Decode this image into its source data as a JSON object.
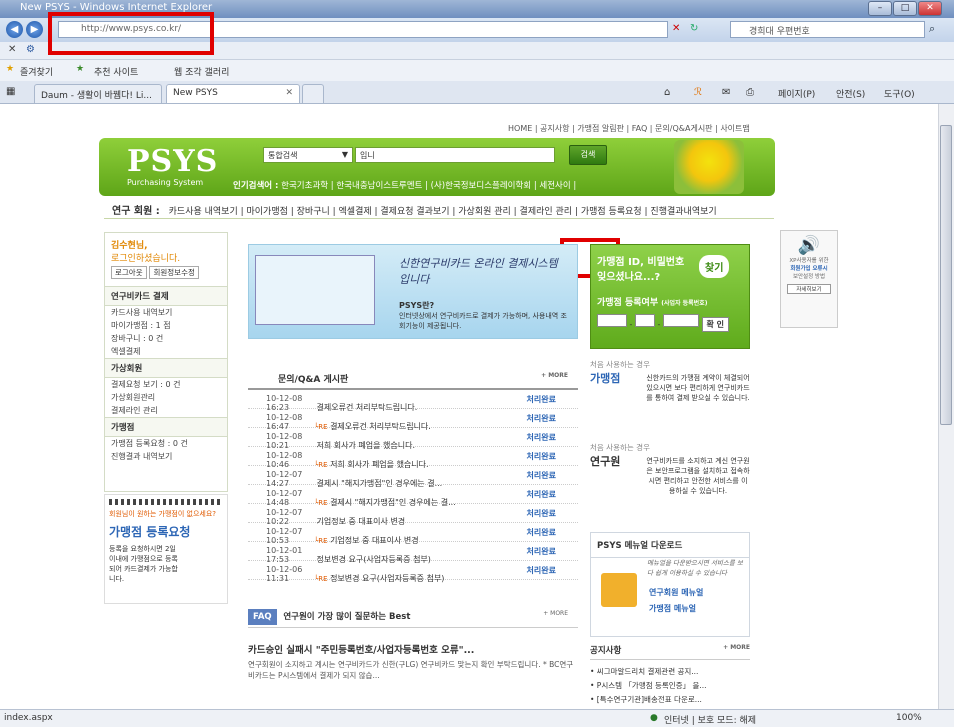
{
  "window": {
    "title": "New PSYS - Windows Internet Explorer",
    "min": "–",
    "max": "□",
    "close": "✕"
  },
  "address": {
    "url": "http://www.psys.co.kr/",
    "search_text": "경희대 우편번호"
  },
  "favorites": {
    "label": "즐겨찾기",
    "suggested": "추천 사이트",
    "gallery": "웹 조각 갤러리"
  },
  "tabs": [
    {
      "label": "Daum - 생활이 바뀀다! Li..."
    },
    {
      "label": "New PSYS"
    }
  ],
  "commandbar": {
    "page": "페이지(P)",
    "safety": "안전(S)",
    "tools": "도구(O)"
  },
  "status": {
    "left": "index.aspx",
    "zone": "인터넷 | 보호 모드: 해제",
    "zoom": "100%"
  },
  "site": {
    "toplinks": "HOME | 공지사항 | 가맹점 알림판 | FAQ | 문의/Q&A게시판 | 사이트맵",
    "logo": "PSYS",
    "logo_sub": "Purchasing System",
    "search_scope": "통합검색",
    "search_value": "입니",
    "search_button": "검색",
    "popular_label": "인기검색어 :",
    "popular_terms": "한국기초과학 | 한국내충남이스트루멘트 | (사)한국정보디스플레이학회 | 세전사이 |",
    "member_label": "연구 회원 :",
    "member_menu": "카드사용 내역보기 | 마이가맹점 | 장바구니 | 엑셀결제 | 결제요청 결과보기 | 가상회원 관리 | 결제라인 관리 | 가맹점 등록요청 | 진행결과내역보기"
  },
  "left": {
    "user": "김수현님,",
    "greeting": "로그인하셨습니다.",
    "logout": "로그아웃",
    "edit": "회원정보수정",
    "sec1": "연구비카드 결제",
    "s1a": "카드사용 내역보기",
    "s1b": "마이가맹점 : 1 점",
    "s1c": "장바구니 : 0 건",
    "s1d": "엑셀결제",
    "sec2": "가상회원",
    "s2a": "결제요청 보기 : 0 건",
    "s2b": "가상회원관리",
    "s2c": "결제라인 관리",
    "sec3": "가맹점",
    "s3a": "가맹점 등록요청 : 0 건",
    "s3b": "진행결과 내역보기",
    "banner_q": "회원님이 원하는 가맹점이 없으세요?",
    "banner_title": "가맹점 등록요청",
    "banner_desc": "등록을 요청하시면 2일이내에 가맹점으로 등록되어 카드결제가 가능합니다."
  },
  "banner": {
    "headline": "신한연구비카드 온라인 결제시스템 입니다",
    "q": "PSYS란?",
    "desc": "인터넷상에서 연구비카드로 결제가 가능하며, 사용내역 조회기능이 제공됩니다."
  },
  "qna": {
    "title": "문의/Q&A 게시판",
    "more": "+ MORE",
    "rows": [
      {
        "date": "10-12-08 16:23",
        "new": "",
        "subject": "결제오류건 처리부탁드립니다.",
        "status": "처리완료"
      },
      {
        "date": "10-12-08 16:47",
        "new": "└RE",
        "subject": "결제오류건 처리부탁드립니다.",
        "status": "처리완료"
      },
      {
        "date": "10-12-08 10:21",
        "new": "",
        "subject": "저희 회사가 폐업을 했습니다.",
        "status": "처리완료"
      },
      {
        "date": "10-12-08 10:46",
        "new": "└RE",
        "subject": "저희 회사가 폐업을 했습니다.",
        "status": "처리완료"
      },
      {
        "date": "10-12-07 14:27",
        "new": "",
        "subject": "결제시 \"해지가맹점\"인 경우에는 결...",
        "status": "처리완료"
      },
      {
        "date": "10-12-07 14:48",
        "new": "└RE",
        "subject": "결제시 \"해지가맹점\"인 경우에는 결...",
        "status": "처리완료"
      },
      {
        "date": "10-12-07 10:22",
        "new": "",
        "subject": "기업정보 중 대표이사 변경",
        "status": "처리완료"
      },
      {
        "date": "10-12-07 10:53",
        "new": "└RE",
        "subject": "기업정보 중 대표이사 변경",
        "status": "처리완료"
      },
      {
        "date": "10-12-01 17:53",
        "new": "",
        "subject": "정보변경 요구(사업자등록증 첨부)",
        "status": "처리완료"
      },
      {
        "date": "10-12-06 11:31",
        "new": "└RE",
        "subject": "정보변경 요구(사업자등록증 첨부)",
        "status": "처리완료"
      }
    ]
  },
  "faq": {
    "badge": "FAQ",
    "title": "연구원이 가장 많이 질문하는 Best",
    "more": "+ MORE",
    "question": "카드승인 실패시 \"주민등록번호/사업자등록번호 오류\"...",
    "answer": "연구회원이 소지하고 계시는 연구비카드가 신한(구LG) 연구비카드 맞는지 확인 부탁드립니다. * BC연구비카드는 P시스템에서 결제가 되지 않습..."
  },
  "right": {
    "find_title": "가맹점 ID, 비밀번호",
    "find_sub": "잊으셨나요...?",
    "find_btn": "찾기",
    "reg_label": "가맹점 등록여부",
    "reg_note": "(사업자 등록번호)",
    "confirm": "확 인",
    "first1": "처음 사용하는 경우",
    "merchant": "가맹점",
    "merchant_desc": "신한카드의 가맹점 계약이 체결되어 있으시면 보다 편리하게 연구비카드를 통하여 결제 받으실 수 있습니다.",
    "first2": "처음 사용하는 경우",
    "researcher": "연구원",
    "researcher_desc": "연구비카드를 소지하고 계신 연구원은 보안프로그램을 설치하고 접속하시면 편리하고 안전한 서비스를 이용하실 수 있습니다.",
    "manual_title": "PSYS 메뉴얼 다운로드",
    "manual_note": "메뉴얼을 다운받으시면 서비스를 보다 쉽게 이용하실 수 있습니다",
    "manual1": "연구회원 메뉴얼",
    "manual2": "가맹점 메뉴얼",
    "notice_title": "공지사항",
    "notice_more": "+ MORE",
    "notice1": "• 씨그마알드리치 결제관련 공지...",
    "notice2": "• P시스템 「가맹점 등록인증」 을...",
    "notice3": "• [특수연구기관]배송전표 다운로..."
  },
  "sidead": {
    "line1": "XP사용자를 위한",
    "line2": "회원가입 오류시",
    "line3": "보안설정 방법",
    "btn": "자세히보기"
  }
}
